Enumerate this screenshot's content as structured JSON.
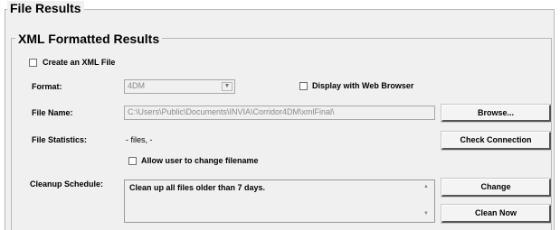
{
  "file_results": {
    "title": "File Results"
  },
  "xml_results": {
    "title": "XML Formatted Results",
    "create_xml_label": "Create an XML File",
    "create_xml_checked": false,
    "format_label": "Format:",
    "format_value": "4DM",
    "display_browser_label": "Display with Web Browser",
    "display_browser_checked": false,
    "file_name_label": "File Name:",
    "file_name_value": "C:\\Users\\Public\\Documents\\INVIA\\Corridor4DM\\xmlFinal\\",
    "browse_label": "Browse...",
    "file_stats_label": "File Statistics:",
    "file_stats_value": "-  files, -",
    "check_connection_label": "Check Connection",
    "allow_change_label": "Allow user to change filename",
    "allow_change_checked": false,
    "cleanup_label": "Cleanup Schedule:",
    "cleanup_text": "Clean up all files older than 7 days.",
    "change_label": "Change",
    "clean_now_label": "Clean Now"
  },
  "icons": {
    "dropdown": "chevron-down-icon",
    "scroll_up": "scroll-up-arrow-icon",
    "scroll_down": "scroll-down-arrow-icon"
  },
  "colors": {
    "panel_bg": "#f0f0f0",
    "group_border": "#b8b8b8",
    "disabled_text": "#8a8a8a"
  }
}
